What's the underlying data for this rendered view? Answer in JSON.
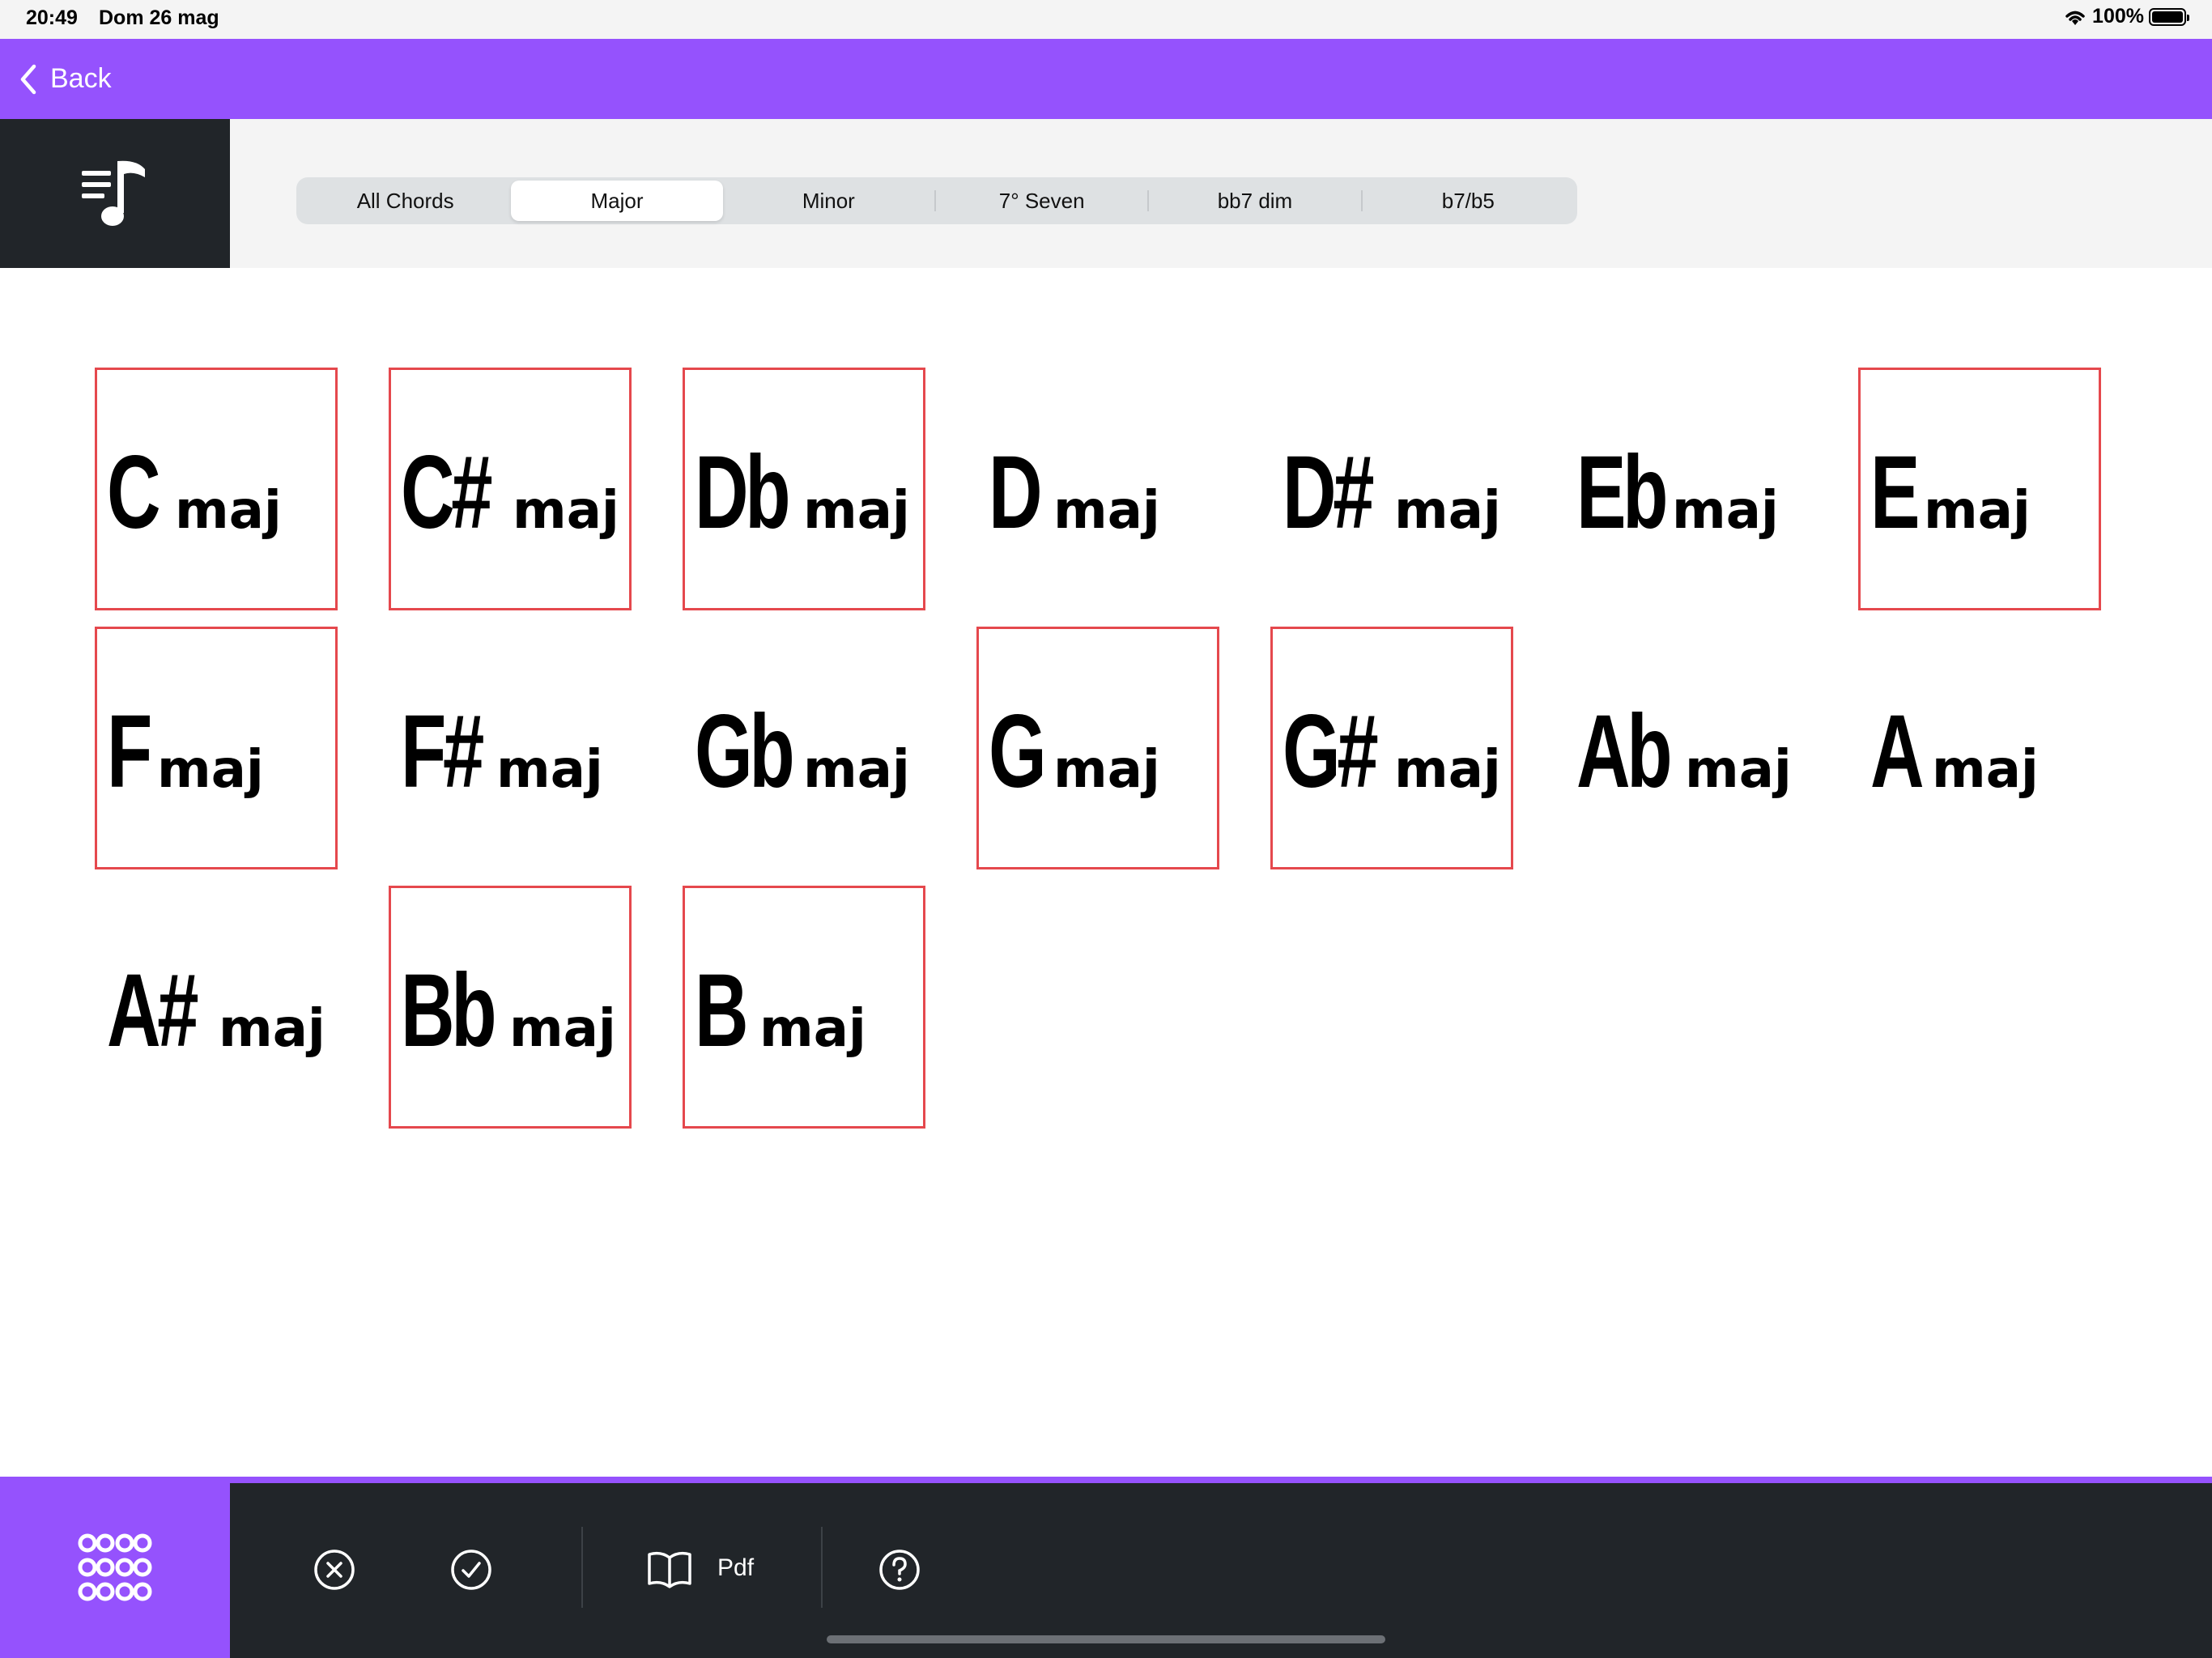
{
  "status_bar": {
    "time": "20:49",
    "date": "Dom 26 mag",
    "battery": "100%"
  },
  "nav": {
    "back_label": "Back"
  },
  "segments": [
    {
      "label": "All Chords",
      "active": false
    },
    {
      "label": "Major",
      "active": true
    },
    {
      "label": "Minor",
      "active": false
    },
    {
      "label": "7° Seven",
      "active": false
    },
    {
      "label": "bb7 dim",
      "active": false
    },
    {
      "label": "b7/b5",
      "active": false
    }
  ],
  "chord_quality": "maj",
  "chords": [
    {
      "root": "C",
      "selected": true
    },
    {
      "root": "C#",
      "selected": true
    },
    {
      "root": "Db",
      "selected": true
    },
    {
      "root": "D",
      "selected": false
    },
    {
      "root": "D#",
      "selected": false
    },
    {
      "root": "Eb",
      "selected": false
    },
    {
      "root": "E",
      "selected": true
    },
    {
      "root": "F",
      "selected": true
    },
    {
      "root": "F#",
      "selected": false
    },
    {
      "root": "Gb",
      "selected": false
    },
    {
      "root": "G",
      "selected": true
    },
    {
      "root": "G#",
      "selected": true
    },
    {
      "root": "Ab",
      "selected": false
    },
    {
      "root": "A",
      "selected": false
    },
    {
      "root": "A#",
      "selected": false
    },
    {
      "root": "Bb",
      "selected": true
    },
    {
      "root": "B",
      "selected": true
    }
  ],
  "toolbar": {
    "pdf_label": "Pdf"
  },
  "colors": {
    "accent": "#9552fd",
    "dark": "#212529",
    "selection": "#e5484d"
  },
  "icons": [
    "music-list-icon",
    "back-chevron-icon",
    "grid-dots-icon",
    "clear-x-icon",
    "check-icon",
    "book-icon",
    "help-icon",
    "wifi-icon",
    "battery-icon"
  ]
}
